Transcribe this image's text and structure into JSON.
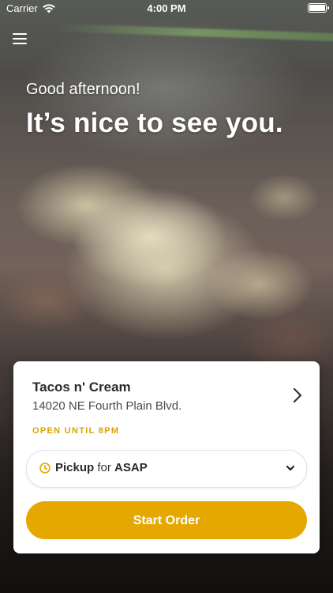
{
  "status_bar": {
    "carrier": "Carrier",
    "time": "4:00 PM"
  },
  "greeting": {
    "salutation": "Good afternoon!",
    "headline": "It’s nice to see you."
  },
  "store": {
    "name": "Tacos n' Cream",
    "address": "14020 NE Fourth Plain Blvd.",
    "status": "OPEN UNTIL 8PM"
  },
  "order": {
    "mode": "Pickup",
    "connector": "for",
    "time": "ASAP",
    "start_label": "Start Order"
  },
  "colors": {
    "accent": "#e4a800",
    "status_text": "#d9a300"
  },
  "icons": {
    "menu": "hamburger-menu-icon",
    "wifi": "wifi-icon",
    "battery": "battery-icon",
    "store_chevron": "chevron-right-icon",
    "clock": "clock-icon",
    "dropdown": "chevron-down-icon"
  }
}
